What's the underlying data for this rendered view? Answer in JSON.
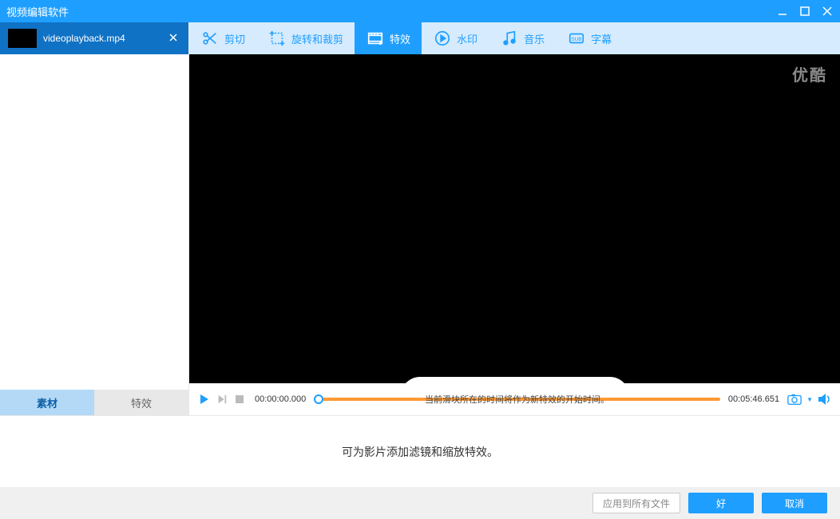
{
  "window": {
    "title": "视频编辑软件"
  },
  "sidebar": {
    "file": {
      "name": "videoplayback.mp4"
    },
    "tabs": {
      "material": "素材",
      "effects": "特效"
    }
  },
  "toolbar": {
    "cut": "剪切",
    "rotate": "旋转和裁剪",
    "effects": "特效",
    "watermark": "水印",
    "music": "音乐",
    "subtitle": "字幕"
  },
  "video": {
    "watermark": "优酷"
  },
  "timeline": {
    "start": "00:00:00.000",
    "hint": "当前滑块所在的时间将作为新特效的开始时间。",
    "end": "00:05:46.651"
  },
  "bottom": {
    "description": "可为影片添加滤镜和缩放特效。",
    "apply_all": "应用到所有文件",
    "ok": "好",
    "cancel": "取消"
  }
}
